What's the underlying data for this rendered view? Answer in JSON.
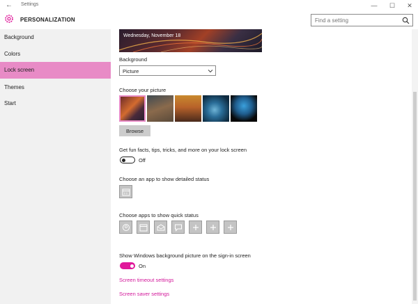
{
  "window": {
    "title": "Settings",
    "back_glyph": "←",
    "minimize_glyph": "—",
    "maximize_glyph": "☐",
    "close_glyph": "✕"
  },
  "header": {
    "title": "PERSONALIZATION",
    "icon": "gear-icon",
    "search_placeholder": "Find a setting"
  },
  "sidebar": {
    "items": [
      {
        "label": "Background"
      },
      {
        "label": "Colors"
      },
      {
        "label": "Lock screen",
        "active": true
      },
      {
        "label": "Themes"
      },
      {
        "label": "Start"
      }
    ]
  },
  "main": {
    "preview_date": "Wednesday, November 18",
    "background": {
      "label": "Background",
      "value": "Picture"
    },
    "choose_picture": {
      "label": "Choose your picture",
      "browse_label": "Browse"
    },
    "fun_facts": {
      "label": "Get fun facts, tips, tricks, and more on your lock screen",
      "state": "Off"
    },
    "detailed_status": {
      "label": "Choose an app to show detailed status",
      "app": "calendar-icon"
    },
    "quick_status": {
      "label": "Choose apps to show quick status",
      "apps": [
        "people-icon",
        "calendar-icon",
        "mail-icon",
        "chat-icon",
        "plus-icon",
        "plus-icon",
        "plus-icon"
      ]
    },
    "signin_background": {
      "label": "Show Windows background picture on the sign-in screen",
      "state": "On"
    },
    "links": {
      "screen_timeout": "Screen timeout settings",
      "screen_saver": "Screen saver settings"
    }
  },
  "colors": {
    "accent": "#e0189a",
    "sidebar_active": "#e88bc6",
    "link": "#d2179a"
  }
}
